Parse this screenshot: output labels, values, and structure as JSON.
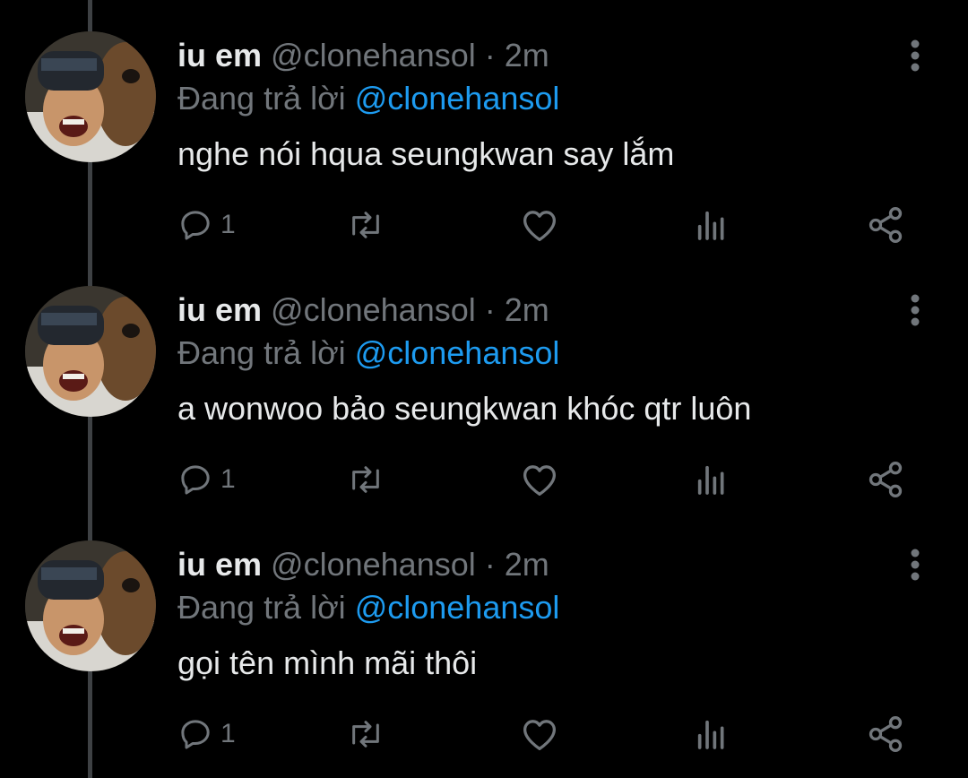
{
  "colors": {
    "background": "#000000",
    "text": "#e7e9ea",
    "secondary": "#71767b",
    "link": "#1d9bf0",
    "thread_line": "#3e4144"
  },
  "tweets": [
    {
      "name": "iu em",
      "handle": "@clonehansol",
      "separator": "·",
      "time": "2m",
      "reply_prefix": "Đang trả lời",
      "reply_mention": "@clonehansol",
      "text": "nghe nói hqua seungkwan say lắm",
      "reply_count": "1"
    },
    {
      "name": "iu em",
      "handle": "@clonehansol",
      "separator": "·",
      "time": "2m",
      "reply_prefix": "Đang trả lời",
      "reply_mention": "@clonehansol",
      "text": "a wonwoo bảo seungkwan khóc qtr luôn",
      "reply_count": "1"
    },
    {
      "name": "iu em",
      "handle": "@clonehansol",
      "separator": "·",
      "time": "2m",
      "reply_prefix": "Đang trả lời",
      "reply_mention": "@clonehansol",
      "text": "gọi tên mình mãi thôi",
      "reply_count": "1"
    }
  ],
  "icons": {
    "avatar": "profile-photo",
    "more": "more-vertical-icon",
    "reply": "comment-bubble-icon",
    "retweet": "retweet-icon",
    "like": "heart-icon",
    "stats": "bar-chart-icon",
    "share": "share-icon"
  }
}
